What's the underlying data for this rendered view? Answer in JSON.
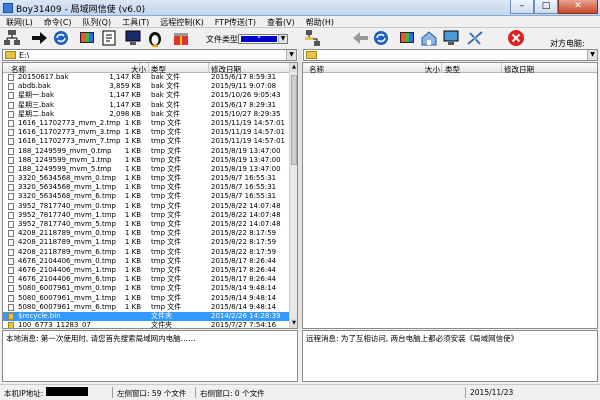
{
  "window": {
    "title": "Boy31409 - 局域网信使 (v6.0)"
  },
  "menu": [
    "联网(L)",
    "命令(C)",
    "队列(Q)",
    "工具(T)",
    "远程控制(K)",
    "FTP传送(T)",
    "查看(V)",
    "帮助(H)"
  ],
  "toolbar": {
    "file_type_label": "文件类型:",
    "file_type_value": "* ",
    "remote_pc_label": "对方电脑:"
  },
  "left_path": "E:\\",
  "right_path": "",
  "columns": {
    "name": "名称",
    "size": "大小",
    "type": "类型",
    "modified": "修改日期"
  },
  "files": [
    {
      "name": "20150617.bak",
      "size": "1,147 KB",
      "type": "bak 文件",
      "date": "2015/6/17 8:59:31"
    },
    {
      "name": "abdb.bak",
      "size": "3,859 KB",
      "type": "bak 文件",
      "date": "2015/9/11 9:07:08"
    },
    {
      "name": "星期一.bak",
      "size": "1,147 KB",
      "type": "bak 文件",
      "date": "2015/10/26 9:05:43"
    },
    {
      "name": "星期三.bak",
      "size": "1,147 KB",
      "type": "bak 文件",
      "date": "2015/6/17 8:29:31"
    },
    {
      "name": "星期二.bak",
      "size": "2,098 KB",
      "type": "bak 文件",
      "date": "2015/10/27 8:29:35"
    },
    {
      "name": "1616_11702773_mvm_2.tmp",
      "size": "1 KB",
      "type": "tmp 文件",
      "date": "2015/11/19 14:57:01"
    },
    {
      "name": "1616_11702773_mvm_3.tmp",
      "size": "1 KB",
      "type": "tmp 文件",
      "date": "2015/11/19 14:57:01"
    },
    {
      "name": "1616_11702773_mvm_7.tmp",
      "size": "1 KB",
      "type": "tmp 文件",
      "date": "2015/11/19 14:57:01"
    },
    {
      "name": "188_1249599_mvm_0.tmp",
      "size": "1 KB",
      "type": "tmp 文件",
      "date": "2015/8/19 13:47:00"
    },
    {
      "name": "188_1249599_mvm_1.tmp",
      "size": "1 KB",
      "type": "tmp 文件",
      "date": "2015/8/19 13:47:00"
    },
    {
      "name": "188_1249599_mvm_5.tmp",
      "size": "1 KB",
      "type": "tmp 文件",
      "date": "2015/8/19 13:47:00"
    },
    {
      "name": "3320_5634568_mvm_0.tmp",
      "size": "1 KB",
      "type": "tmp 文件",
      "date": "2015/8/7 16:55:31"
    },
    {
      "name": "3320_5634568_mvm_1.tmp",
      "size": "1 KB",
      "type": "tmp 文件",
      "date": "2015/8/7 16:55:31"
    },
    {
      "name": "3320_5634568_mvm_6.tmp",
      "size": "1 KB",
      "type": "tmp 文件",
      "date": "2015/8/7 16:55:31"
    },
    {
      "name": "3952_7817740_mvm_0.tmp",
      "size": "1 KB",
      "type": "tmp 文件",
      "date": "2015/8/22 14:07:48"
    },
    {
      "name": "3952_7817740_mvm_1.tmp",
      "size": "1 KB",
      "type": "tmp 文件",
      "date": "2015/8/22 14:07:48"
    },
    {
      "name": "3952_7817740_mvm_5.tmp",
      "size": "1 KB",
      "type": "tmp 文件",
      "date": "2015/8/22 14:07:48"
    },
    {
      "name": "4208_2118789_mvm_0.tmp",
      "size": "1 KB",
      "type": "tmp 文件",
      "date": "2015/8/22 8:17:59"
    },
    {
      "name": "4208_2118789_mvm_1.tmp",
      "size": "1 KB",
      "type": "tmp 文件",
      "date": "2015/8/22 8:17:59"
    },
    {
      "name": "4208_2118789_mvm_6.tmp",
      "size": "1 KB",
      "type": "tmp 文件",
      "date": "2015/8/22 8:17:59"
    },
    {
      "name": "4676_2104406_mvm_0.tmp",
      "size": "1 KB",
      "type": "tmp 文件",
      "date": "2015/8/17 8:26:44"
    },
    {
      "name": "4676_2104406_mvm_1.tmp",
      "size": "1 KB",
      "type": "tmp 文件",
      "date": "2015/8/17 8:26:44"
    },
    {
      "name": "4676_2104406_mvm_6.tmp",
      "size": "1 KB",
      "type": "tmp 文件",
      "date": "2015/8/17 8:26:44"
    },
    {
      "name": "5080_6007961_mvm_0.tmp",
      "size": "1 KB",
      "type": "tmp 文件",
      "date": "2015/8/14 9:48:14"
    },
    {
      "name": "5080_6007961_mvm_1.tmp",
      "size": "1 KB",
      "type": "tmp 文件",
      "date": "2015/8/14 9:48:14"
    },
    {
      "name": "5080_6007961_mvm_6.tmp",
      "size": "1 KB",
      "type": "tmp 文件",
      "date": "2015/8/14 9:48:14"
    },
    {
      "name": "$recycle.bin",
      "size": "",
      "type": "文件夹",
      "date": "2014/2/26 14:28:39",
      "selected": true,
      "folder": true
    },
    {
      "name": "100_6773_11283_07",
      "size": "",
      "type": "文件夹",
      "date": "2015/7/27 7:54:16",
      "folder": true
    }
  ],
  "messages": {
    "local": "本地消息: 第一次使用时, 请您首先搜索局域网内电脑……",
    "remote": "远程消息: 为了互相访问, 两台电脑上都必须安装《局域网信使》"
  },
  "status": {
    "ip_label": "本机IP地址:",
    "left_window": "左侧窗口: 59 个文件",
    "right_window": "右侧窗口: 0 个文件",
    "date": "2015/11/23"
  }
}
